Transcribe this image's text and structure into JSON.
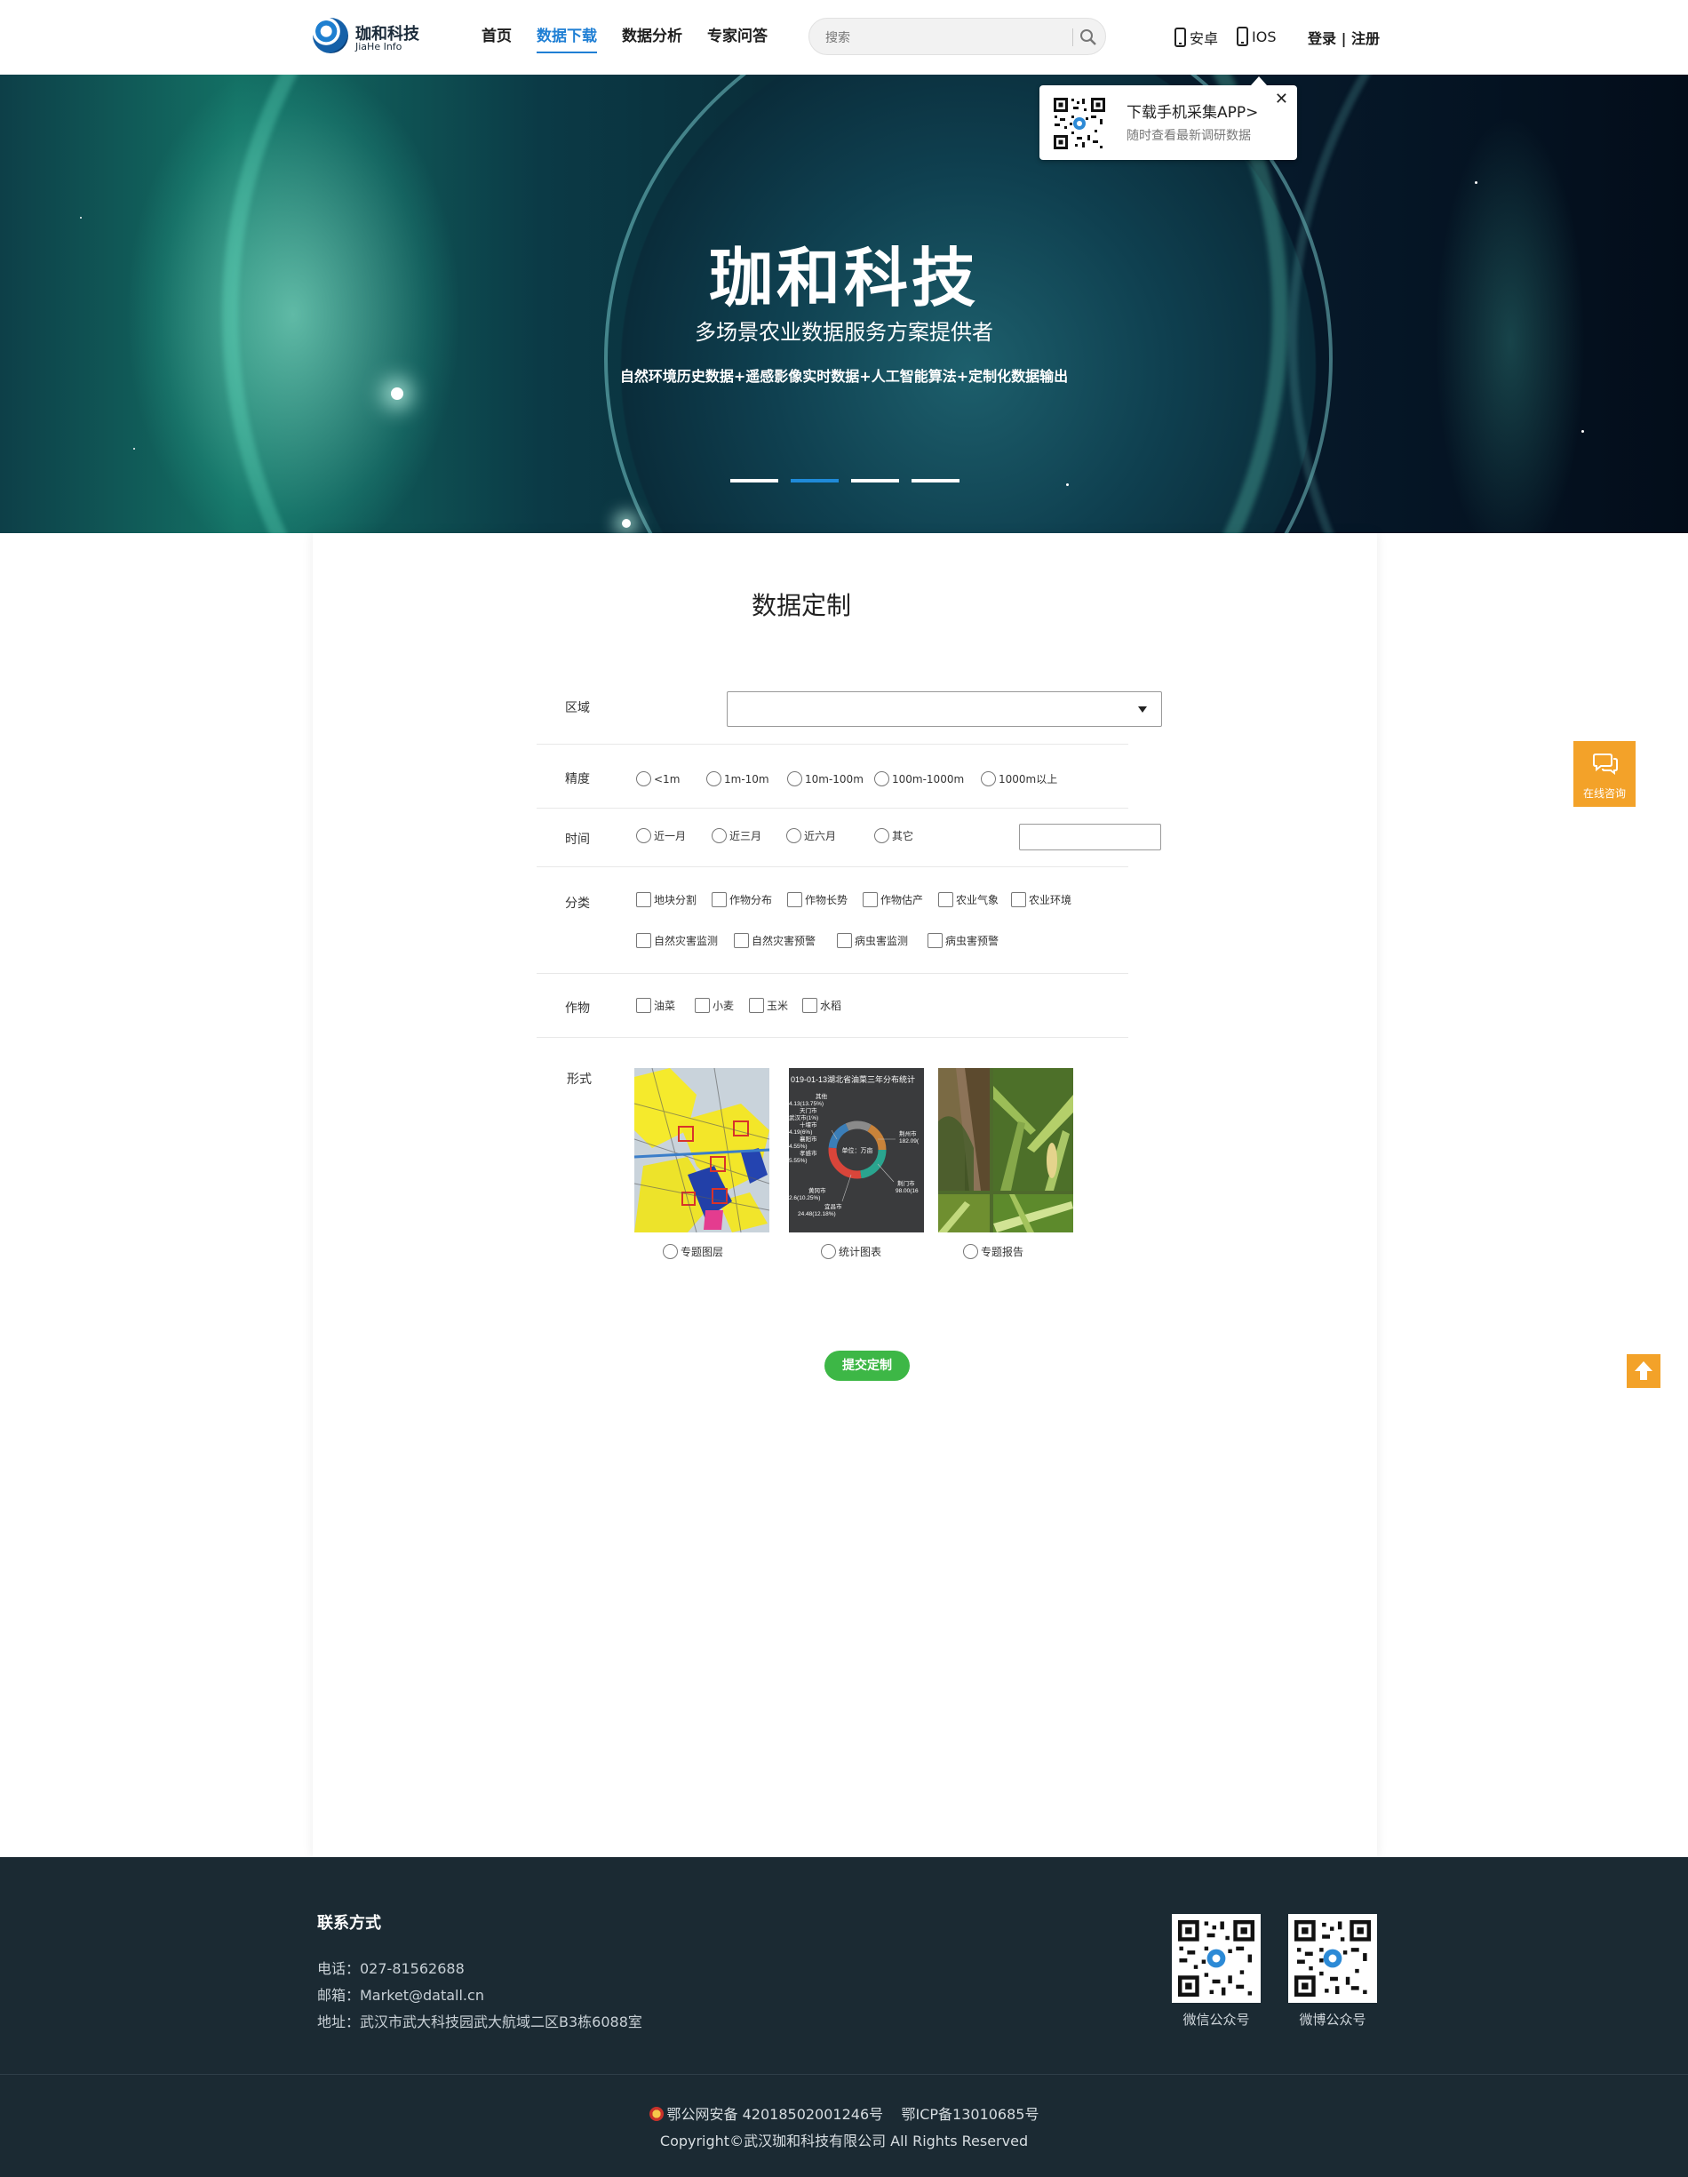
{
  "header": {
    "logo_cn": "珈和科技",
    "logo_en": "JiaHe Info",
    "nav": [
      {
        "label": "首页",
        "active": false
      },
      {
        "label": "数据下载",
        "active": true
      },
      {
        "label": "数据分析",
        "active": false
      },
      {
        "label": "专家问答",
        "active": false
      }
    ],
    "search_placeholder": "搜索",
    "android_label": "安卓",
    "ios_label": "IOS",
    "login_label": "登录",
    "register_label": "注册",
    "separator": " | "
  },
  "app_popup": {
    "title": "下载手机采集APP>",
    "subtitle": "随时查看最新调研数据",
    "close": "✕"
  },
  "banner": {
    "title": "珈和科技",
    "subtitle": "多场景农业数据服务方案提供者",
    "description": "自然环境历史数据+遥感影像实时数据+人工智能算法+定制化数据输出",
    "slides": 4,
    "active_slide": 2
  },
  "form": {
    "title": "数据定制",
    "region_label": "区域",
    "region_value": "",
    "precision_label": "精度",
    "precision_options": [
      "<1m",
      "1m-10m",
      "10m-100m",
      "100m-1000m",
      "1000m以上"
    ],
    "time_label": "时间",
    "time_options": [
      "近一月",
      "近三月",
      "近六月",
      "其它"
    ],
    "time_other_value": "",
    "category_label": "分类",
    "category_options_row1": [
      "地块分割",
      "作物分布",
      "作物长势",
      "作物估产",
      "农业气象",
      "农业环境"
    ],
    "category_options_row2": [
      "自然灾害监测",
      "自然灾害预警",
      "病虫害监测",
      "病虫害预警"
    ],
    "crop_label": "作物",
    "crop_options": [
      "油菜",
      "小麦",
      "玉米",
      "水稻"
    ],
    "format_label": "形式",
    "format_options": [
      "专题图层",
      "统计图表",
      "专题报告"
    ],
    "chart_thumb": {
      "title": "019-01-13湖北省油菜三年分布统计",
      "center_label": "单位：万亩",
      "left_labels": [
        "其他",
        "4.13(13.75%)",
        "天门市",
        "武汉市(1%)",
        "十堰市",
        "4.19(6%)",
        "襄阳市",
        "4.55%)",
        "孝感市",
        "5.55%)",
        "黄冈市",
        "2.6(10.25%)"
      ],
      "right_labels": [
        "荆州市",
        "182.09(",
        "荆门市",
        "98.00(16"
      ],
      "bottom_labels": [
        "宜昌市",
        "24.48(12.18%)"
      ]
    },
    "submit_label": "提交定制"
  },
  "side": {
    "consult_label": "在线咨询"
  },
  "footer": {
    "contact_title": "联系方式",
    "phone": "电话：027-81562688",
    "email": "邮箱：Market@datall.cn",
    "address": "地址：武汉市武大科技园武大航域二区B3栋6088室",
    "qr_wechat_label": "微信公众号",
    "qr_weibo_label": "微博公众号",
    "beian": "鄂公网安备 42018502001246号",
    "icp": "鄂ICP备13010685号",
    "copyright": "Copyright©武汉珈和科技有限公司 All Rights Reserved"
  },
  "colors": {
    "accent_blue": "#1f7fd4",
    "submit_green": "#3db746",
    "side_orange": "#f3a229",
    "footer_bg": "#1b2a33"
  }
}
